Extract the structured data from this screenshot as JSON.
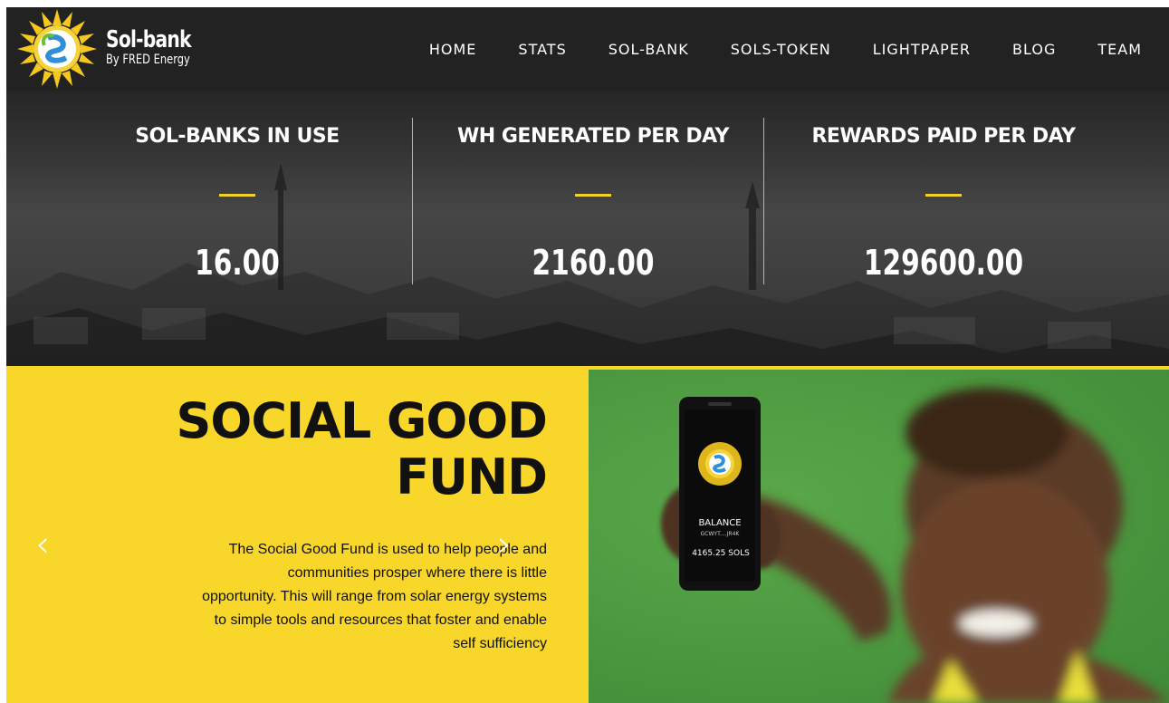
{
  "brand": {
    "title": "Sol-bank",
    "subtitle": "By FRED Energy",
    "logo_icon": "sun-logo-icon"
  },
  "nav": {
    "items": [
      {
        "label": "HOME"
      },
      {
        "label": "STATS"
      },
      {
        "label": "SOL-BANK"
      },
      {
        "label": "SOLS-TOKEN"
      },
      {
        "label": "LIGHTPAPER"
      },
      {
        "label": "BLOG"
      },
      {
        "label": "TEAM"
      }
    ]
  },
  "stats": [
    {
      "label": "SOL-BANKS IN USE",
      "value": "16.00"
    },
    {
      "label": "WH GENERATED PER DAY",
      "value": "2160.00"
    },
    {
      "label": "REWARDS PAID PER DAY",
      "value": "129600.00"
    }
  ],
  "social_good": {
    "title_line1": "SOCIAL GOOD",
    "title_line2": "FUND",
    "paragraph_line1": "The Social Good Fund is used to help people and",
    "paragraph_line2": "communities prosper where there is little",
    "paragraph_line3": "opportunity. This will range from solar energy systems",
    "paragraph_line4": "to simple tools and resources that foster and enable",
    "paragraph_line5": "self sufficiency",
    "prev_arrow": "‹",
    "next_arrow": "›"
  },
  "phone": {
    "balance_label": "BALANCE",
    "address": "GCWYT....JR4K",
    "amount": "4165.25 SOLS"
  },
  "colors": {
    "header_bg": "#222222",
    "accent_yellow": "#f8d72a",
    "photo_green": "#4f9c42"
  }
}
